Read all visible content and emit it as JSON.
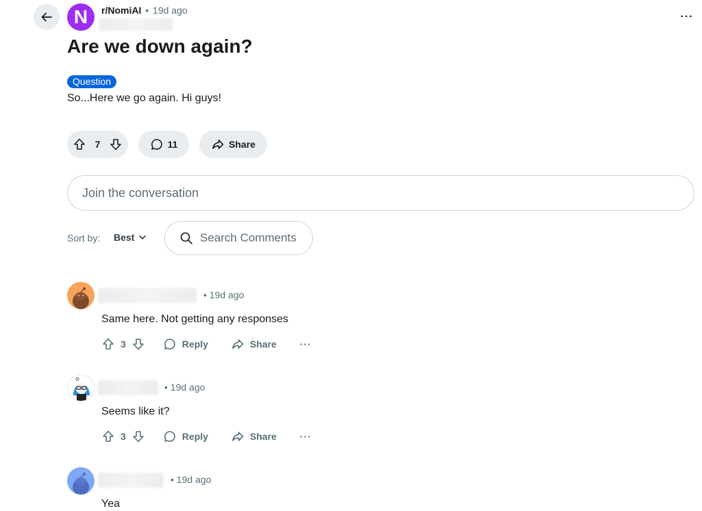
{
  "post": {
    "subreddit": "r/NomiAI",
    "avatar_letter": "N",
    "separator": "•",
    "age": "19d ago",
    "title": "Are we down again?",
    "flair": "Question",
    "body": "So...Here we go again. Hi guys!",
    "score": "7",
    "comment_count": "11",
    "share_label": "Share",
    "overflow": "···",
    "colors": {
      "subreddit_avatar": "#9d2df0",
      "flair": "#0a65dc"
    }
  },
  "composer": {
    "placeholder": "Join the conversation"
  },
  "sort": {
    "label": "Sort by:",
    "value": "Best"
  },
  "search": {
    "placeholder": "Search Comments"
  },
  "comments": [
    {
      "age": "• 19d ago",
      "text": "Same here. Not getting any responses",
      "score": "3",
      "reply_label": "Reply",
      "share_label": "Share",
      "more": "···",
      "avatar_color": "#f7a35c"
    },
    {
      "age": "• 19d ago",
      "text": "Seems like it?",
      "score": "3",
      "reply_label": "Reply",
      "share_label": "Share",
      "more": "···",
      "avatar_color": "#ffffff"
    },
    {
      "age": "• 19d ago",
      "text": "Yea",
      "avatar_color": "#7fa8f5"
    }
  ]
}
